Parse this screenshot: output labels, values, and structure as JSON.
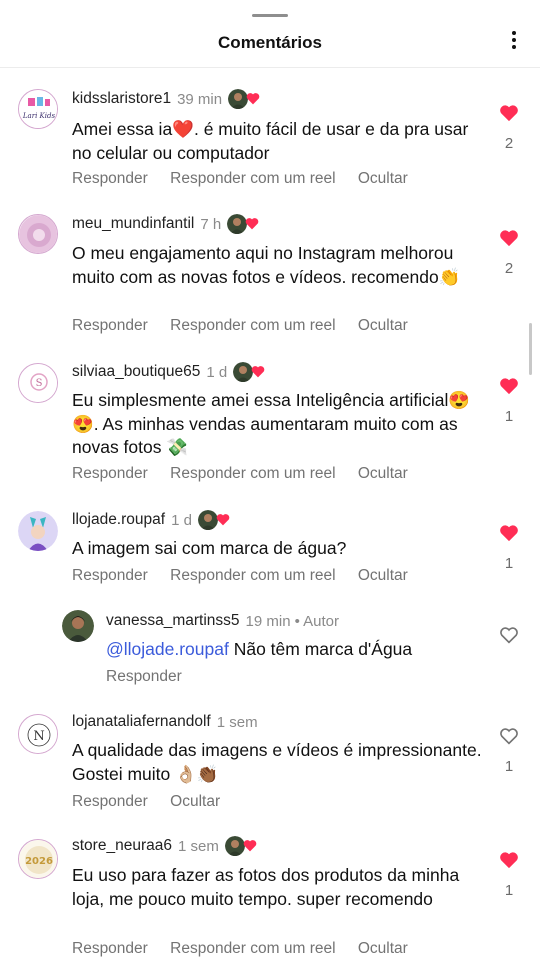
{
  "header": {
    "title": "Comentários"
  },
  "comments": [
    {
      "username": "kidsslaristore1",
      "time": "39 min",
      "text": "Amei essa ia❤️. é muito fácil de usar e da pra usar no celular ou computador",
      "likes": "2",
      "liked": true,
      "actions": [
        "Responder",
        "Responder com um reel",
        "Ocultar"
      ],
      "avatar_text": "Lari Kids"
    },
    {
      "username": "meu_mundinfantil",
      "time": "7 h",
      "text": "O meu engajamento aqui no Instagram melhorou muito com as novas fotos e vídeos. recomendo👏",
      "likes": "2",
      "liked": true,
      "actions": [
        "Responder",
        "Responder com um reel",
        "Ocultar"
      ]
    },
    {
      "username": "silviaa_boutique65",
      "time": "1 d",
      "text": "Eu simplesmente amei essa Inteligência artificial😍😍. As minhas vendas aumentaram muito com as novas fotos 💸",
      "likes": "1",
      "liked": true,
      "actions": [
        "Responder",
        "Responder com um reel",
        "Ocultar"
      ]
    },
    {
      "username": "llojade.roupaf",
      "time": "1 d",
      "text": "A imagem sai com marca de água?",
      "likes": "1",
      "liked": true,
      "actions": [
        "Responder",
        "Responder com um reel",
        "Ocultar"
      ]
    },
    {
      "username": "lojanataliafernandolf",
      "time": "1 sem",
      "text": "A qualidade das imagens e vídeos é impressionante. Gostei muito 👌🏼👏🏾",
      "likes": "1",
      "liked": false,
      "actions": [
        "Responder",
        "Ocultar"
      ],
      "avatar_text": "N"
    },
    {
      "username": "store_neuraa6",
      "time": "1 sem",
      "text": "Eu uso para fazer as fotos dos produtos da minha loja, me pouco muito tempo. super recomendo",
      "likes": "1",
      "liked": true,
      "actions": [
        "Responder",
        "Responder com um reel",
        "Ocultar"
      ],
      "avatar_text": "2026"
    }
  ],
  "reply": {
    "username": "vanessa_martinss5",
    "time": "19 min",
    "author_label": "• Autor",
    "mention": "@llojade.roupaf",
    "text": "Não têm marca d'Água",
    "action": "Responder",
    "liked": false
  },
  "colors": {
    "heart": "#ff2d55",
    "mention": "#3b5bdb",
    "muted": "#737373"
  }
}
